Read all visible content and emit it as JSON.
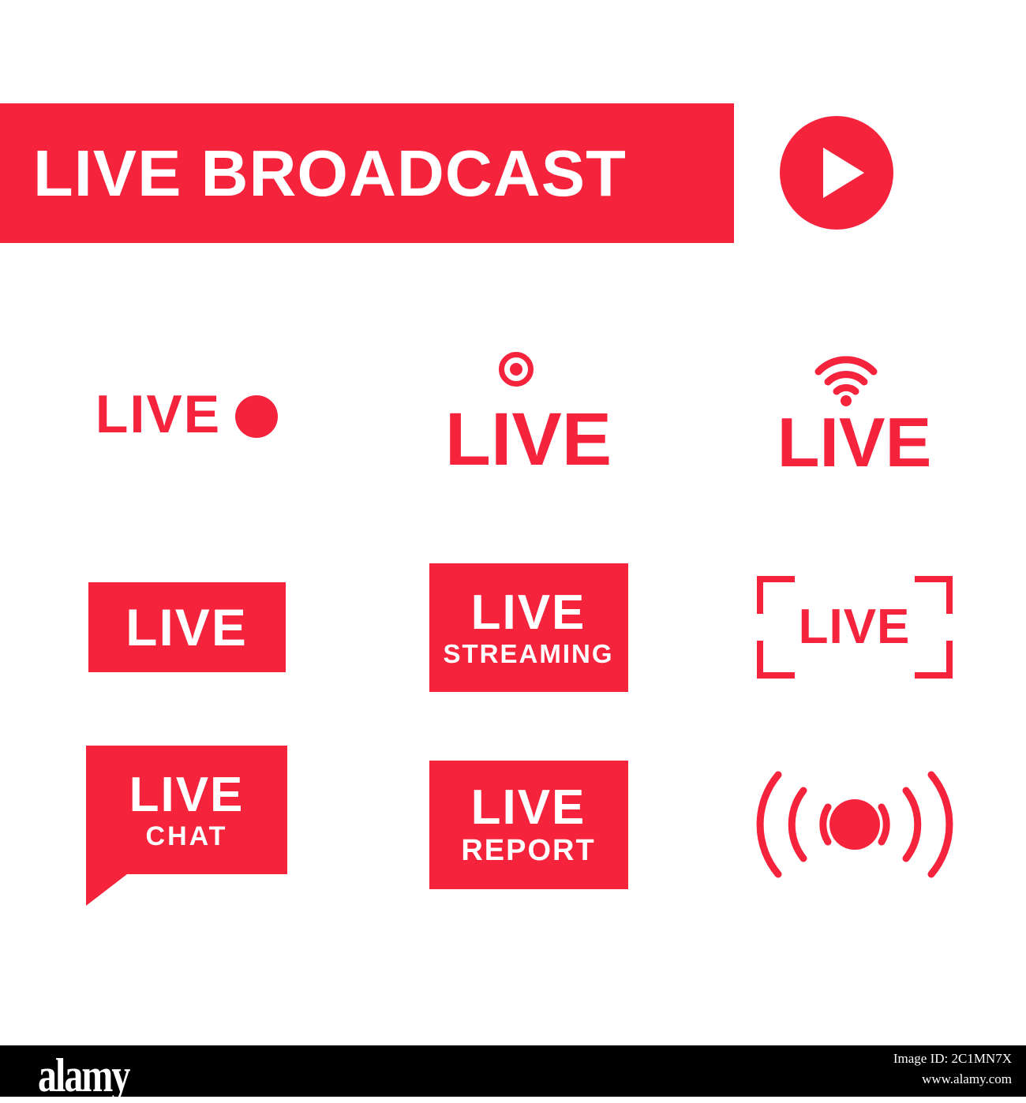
{
  "header": {
    "banner_text": "LIVE BROADCAST",
    "play_icon": "play-triangle-icon"
  },
  "colors": {
    "brand_red": "#f5233c",
    "white": "#ffffff",
    "footer_black": "#000000"
  },
  "badges": [
    {
      "id": "live-with-dot",
      "style": "text-with-dot",
      "text": "LIVE",
      "icon": "record-dot-icon"
    },
    {
      "id": "live-record-dot",
      "style": "text-with-record-ring",
      "text": "LIVE",
      "icon": "record-ring-icon"
    },
    {
      "id": "live-wifi",
      "style": "text-with-wifi",
      "text": "LIVE",
      "icon": "wifi-signal-icon"
    },
    {
      "id": "live-box",
      "style": "solid-box",
      "text": "LIVE"
    },
    {
      "id": "live-streaming-box",
      "style": "solid-box-two-line",
      "text": "LIVE",
      "subtext": "STREAMING"
    },
    {
      "id": "live-brackets",
      "style": "corner-brackets",
      "text": "LIVE",
      "icon": "viewfinder-brackets-icon"
    },
    {
      "id": "live-chat-bubble",
      "style": "speech-bubble",
      "text": "LIVE",
      "subtext": "CHAT"
    },
    {
      "id": "live-report-box",
      "style": "solid-box-two-line",
      "text": "LIVE",
      "subtext": "REPORT"
    },
    {
      "id": "broadcast-waves",
      "style": "icon-only",
      "icon": "broadcast-waves-icon"
    }
  ],
  "footer": {
    "logo": "alamy",
    "image_id": "Image ID: 2C1MN7X",
    "website": "www.alamy.com"
  }
}
